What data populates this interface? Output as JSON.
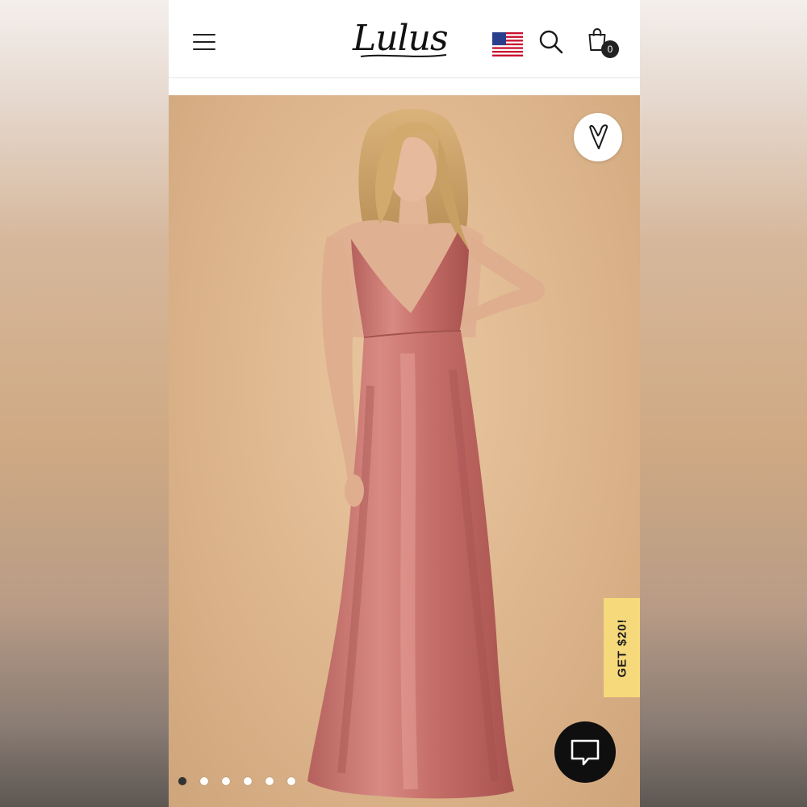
{
  "header": {
    "logo_text": "Lulus",
    "bag_count": "0",
    "menu_icon": "hamburger-menu-icon",
    "flag_icon": "us-flag-icon",
    "search_icon": "search-icon",
    "bag_icon": "shopping-bag-icon"
  },
  "product": {
    "image_alt": "model wearing a rose pink velvet maxi dress",
    "dress_color": "#c9746e",
    "favorite_icon": "heart-icon"
  },
  "promo": {
    "label": "GET $20!",
    "color": "#f6d97a"
  },
  "chat": {
    "icon": "chat-bubble-icon"
  },
  "carousel": {
    "total": 6,
    "active_index": 0
  }
}
